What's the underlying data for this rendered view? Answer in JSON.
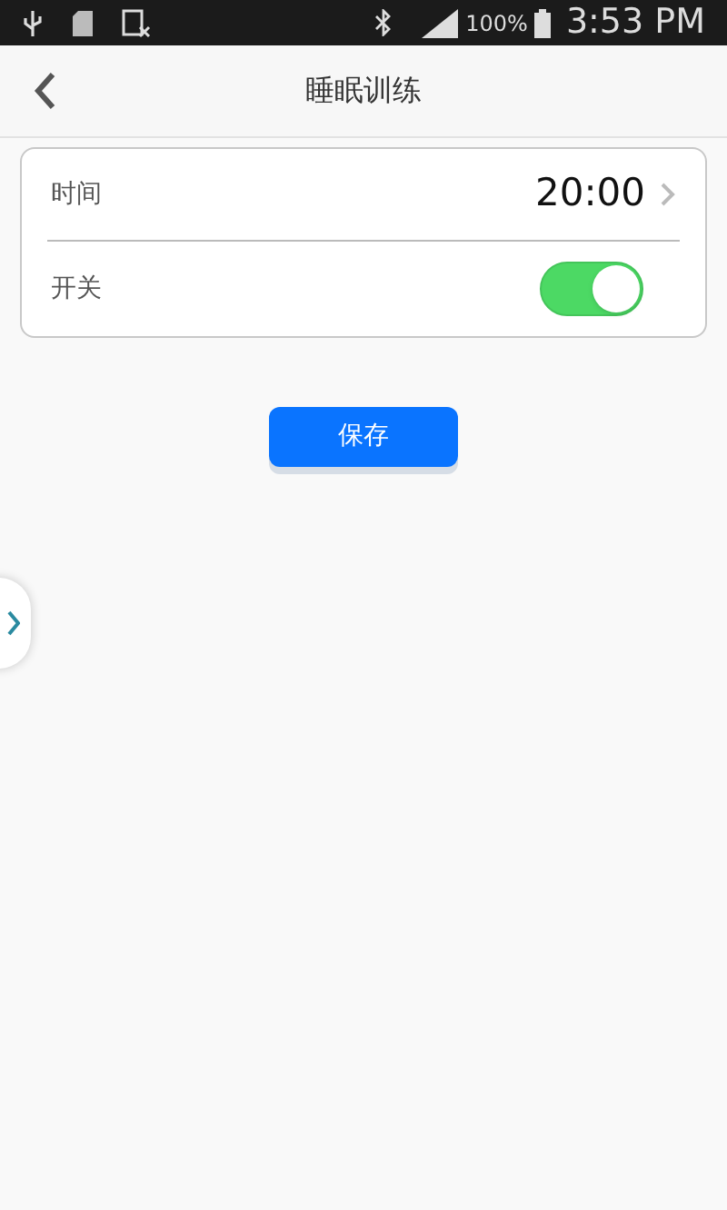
{
  "status_bar": {
    "battery": "100%",
    "time": "3:53 PM"
  },
  "header": {
    "title": "睡眠训练"
  },
  "settings": [
    {
      "kind": "value",
      "label": "时间",
      "value": "20:00"
    },
    {
      "kind": "toggle",
      "label": "开关",
      "on": true
    }
  ],
  "save_button": "保存"
}
